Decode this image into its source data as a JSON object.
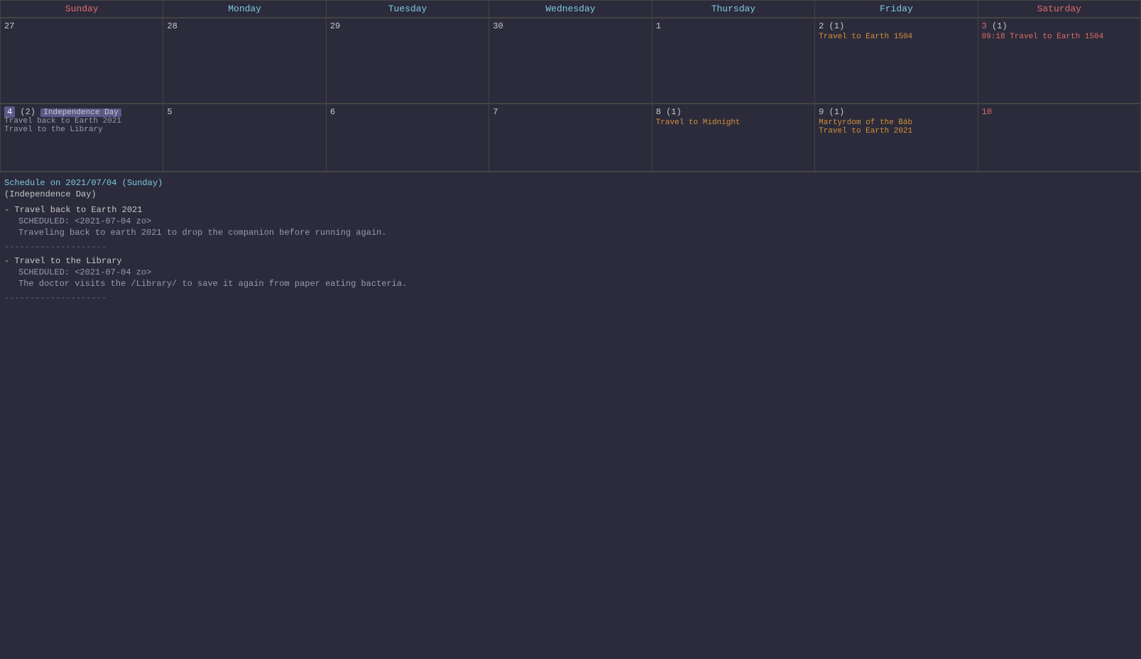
{
  "calendar": {
    "headers": [
      {
        "label": "Sunday",
        "class": "sunday"
      },
      {
        "label": "Monday",
        "class": "monday"
      },
      {
        "label": "Tuesday",
        "class": "tuesday"
      },
      {
        "label": "Wednesday",
        "class": "wednesday"
      },
      {
        "label": "Thursday",
        "class": "thursday"
      },
      {
        "label": "Friday",
        "class": "friday"
      },
      {
        "label": "Saturday",
        "class": "saturday"
      }
    ],
    "week1": [
      {
        "day": "27",
        "events": [],
        "dayClass": ""
      },
      {
        "day": "28",
        "events": [],
        "dayClass": ""
      },
      {
        "day": "29",
        "events": [],
        "dayClass": ""
      },
      {
        "day": "30",
        "events": [],
        "dayClass": ""
      },
      {
        "day": "1",
        "events": [],
        "dayClass": ""
      },
      {
        "day": "2",
        "count": "(1)",
        "events": [
          {
            "text": "Travel to Earth 1504",
            "color": "orange"
          }
        ],
        "dayClass": ""
      },
      {
        "day": "3",
        "count": "(1)",
        "events": [
          {
            "text": "09:18 Travel to Earth 1504",
            "color": "red"
          }
        ],
        "dayClass": "saturday"
      }
    ],
    "week2": [
      {
        "day": "4",
        "highlight": true,
        "holiday": "Independence Day",
        "count": "(2)",
        "events": [
          {
            "text": "Travel back to Earth 2021",
            "color": "gray"
          },
          {
            "text": "Travel to the Library",
            "color": "gray"
          }
        ],
        "dayClass": "sunday-special"
      },
      {
        "day": "5",
        "events": [],
        "dayClass": ""
      },
      {
        "day": "6",
        "events": [],
        "dayClass": ""
      },
      {
        "day": "7",
        "events": [],
        "dayClass": ""
      },
      {
        "day": "8",
        "count": "(1)",
        "events": [
          {
            "text": "Travel to Midnight",
            "color": "orange"
          }
        ],
        "dayClass": ""
      },
      {
        "day": "9",
        "count": "(1)",
        "holiday": "Martyrdom of the Báb",
        "events": [
          {
            "text": "Travel to Earth 2021",
            "color": "orange"
          }
        ],
        "dayClass": ""
      },
      {
        "day": "10",
        "events": [],
        "dayClass": "saturday"
      }
    ]
  },
  "schedule": {
    "title": "Schedule on 2021/07/04 (Sunday)",
    "holiday": "(Independence Day)",
    "entries": [
      {
        "title": "- Travel back to Earth 2021",
        "scheduled": "SCHEDULED: <2021-07-04 zo>",
        "desc": "Traveling back to earth 2021 to drop the companion before running again."
      },
      {
        "title": "- Travel to the Library",
        "scheduled": "SCHEDULED: <2021-07-04 zo>",
        "desc": "The doctor visits the /Library/ to save it again from paper eating bacteria."
      }
    ],
    "divider": "--------------------"
  }
}
